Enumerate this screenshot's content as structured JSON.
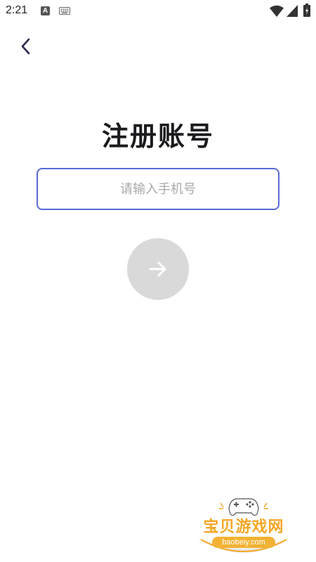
{
  "status_bar": {
    "time": "2:21",
    "notification_icons": [
      "a-icon",
      "keyboard-icon"
    ],
    "system_icons": [
      "wifi-icon",
      "signal-icon",
      "battery-icon"
    ]
  },
  "nav": {
    "back_icon": "chevron-left-icon"
  },
  "page": {
    "title": "注册账号"
  },
  "form": {
    "phone_placeholder": "请输入手机号",
    "phone_value": "",
    "next_icon": "arrow-right-icon"
  },
  "watermark": {
    "title": "宝贝游戏网",
    "url": "baobeiy.com"
  },
  "colors": {
    "input_border": "#5a6ad6",
    "next_button_bg": "#d9d9d9",
    "title_text": "#1b1b1f",
    "watermark_accent": "#f5a623"
  }
}
